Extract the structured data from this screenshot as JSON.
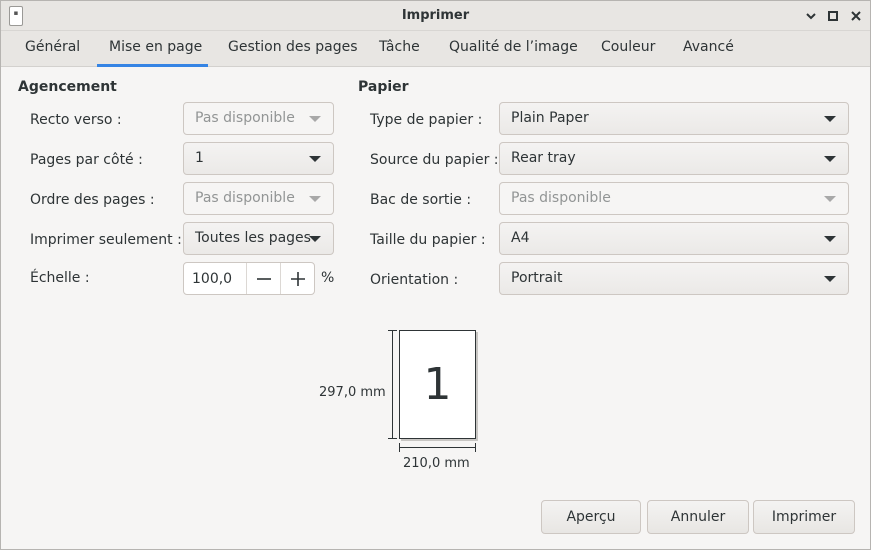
{
  "window": {
    "title": "Imprimer",
    "minimize_glyph": "⌄",
    "maximize_glyph": "☐",
    "close_glyph": "✕"
  },
  "tabs": [
    {
      "label": "Général"
    },
    {
      "label": "Mise en page",
      "active": true
    },
    {
      "label": "Gestion des pages"
    },
    {
      "label": "Tâche"
    },
    {
      "label": "Qualité de l’image"
    },
    {
      "label": "Couleur"
    },
    {
      "label": "Avancé"
    }
  ],
  "layout_section": {
    "title": "Agencement",
    "recto_verso": {
      "label": "Recto verso :",
      "value": "Pas disponible",
      "disabled": true
    },
    "pages_per_side": {
      "label": "Pages par côté :",
      "value": "1"
    },
    "page_order": {
      "label": "Ordre des pages :",
      "value": "Pas disponible",
      "disabled": true
    },
    "print_only": {
      "label": "Imprimer seulement :",
      "value": "Toutes les pages"
    },
    "scale": {
      "label": "Échelle :",
      "value": "100,0",
      "unit": "%",
      "minus": "—",
      "plus": "+"
    }
  },
  "paper_section": {
    "title": "Papier",
    "paper_type": {
      "label": "Type de papier :",
      "value": "Plain Paper"
    },
    "paper_source": {
      "label": "Source du papier :",
      "value": "Rear tray"
    },
    "output_tray": {
      "label": "Bac de sortie :",
      "value": "Pas disponible",
      "disabled": true
    },
    "paper_size": {
      "label": "Taille du papier :",
      "value": "A4"
    },
    "orientation": {
      "label": "Orientation :",
      "value": "Portrait"
    }
  },
  "preview": {
    "page_number": "1",
    "height_label": "297,0 mm",
    "width_label": "210,0 mm"
  },
  "buttons": {
    "preview": "Aperçu",
    "cancel": "Annuler",
    "print": "Imprimer"
  },
  "colors": {
    "accent": "#3584e4",
    "window_bg": "#f6f5f4",
    "header_bg": "#e8e6e3",
    "disabled_text": "#929595"
  }
}
